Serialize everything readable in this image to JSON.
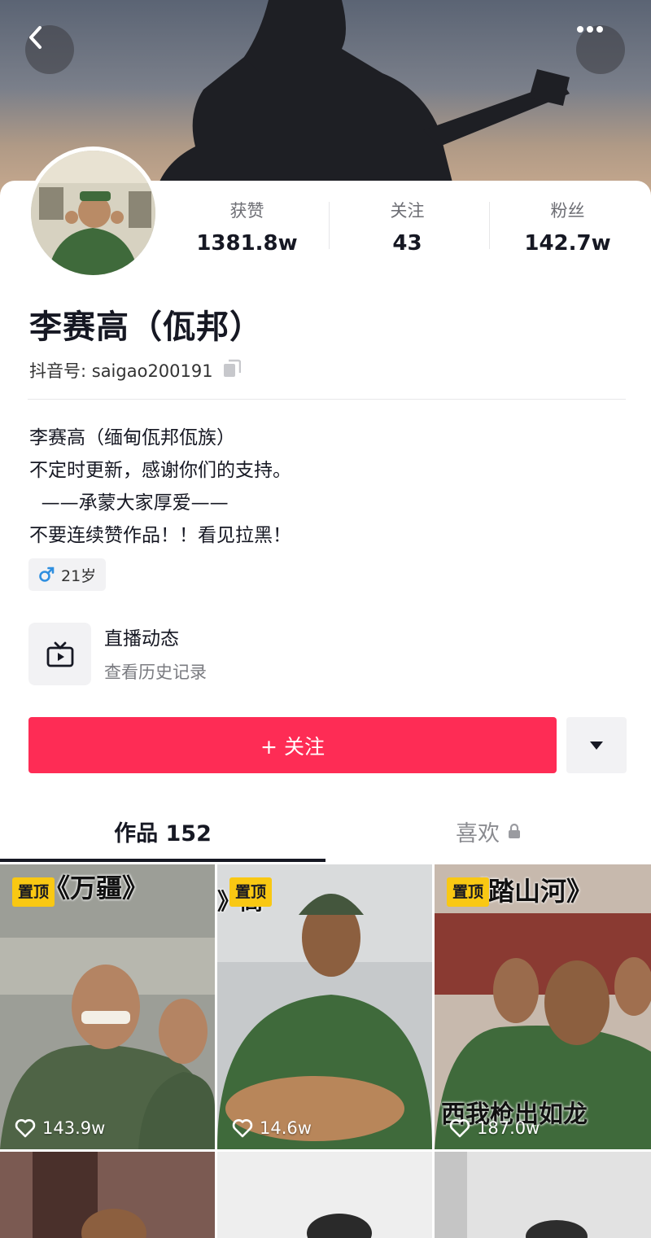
{
  "header": {
    "back_icon": "chevron-left-icon",
    "more_icon": "ellipsis-icon"
  },
  "profile": {
    "name": "李赛高（佤邦）",
    "douyin_id_label": "抖音号: saigao200191",
    "stats": [
      {
        "label": "获赞",
        "value": "1381.8w"
      },
      {
        "label": "关注",
        "value": "43"
      },
      {
        "label": "粉丝",
        "value": "142.7w"
      }
    ],
    "bio_lines": [
      "李赛高（缅甸佤邦佤族）",
      "不定时更新，感谢你们的支持。",
      "  ——承蒙大家厚爱——",
      "不要连续赞作品！！看见拉黑！"
    ],
    "age_tag": "21岁",
    "gender_icon": "male-icon"
  },
  "live": {
    "title": "直播动态",
    "subtitle": "查看历史记录",
    "icon": "tv-play-icon"
  },
  "actions": {
    "follow_label": "+ 关注",
    "dropdown_icon": "triangle-down-icon"
  },
  "tabs": [
    {
      "label": "作品 152",
      "active": true
    },
    {
      "label": "喜欢",
      "active": false,
      "icon": "lock-icon"
    }
  ],
  "videos": [
    {
      "pinned_label": "置顶",
      "overlay": "《万疆》",
      "likes": "143.9w"
    },
    {
      "pinned_label": "置顶",
      "overlay": "》高",
      "likes": "14.6w"
    },
    {
      "pinned_label": "置顶",
      "overlay": "《踏山河》",
      "overlay2": "西我枪出如龙",
      "likes": "187.0w"
    }
  ],
  "colors": {
    "accent": "#fe2c55",
    "pin": "#f9c813",
    "uniform": "#3f6a3b"
  }
}
